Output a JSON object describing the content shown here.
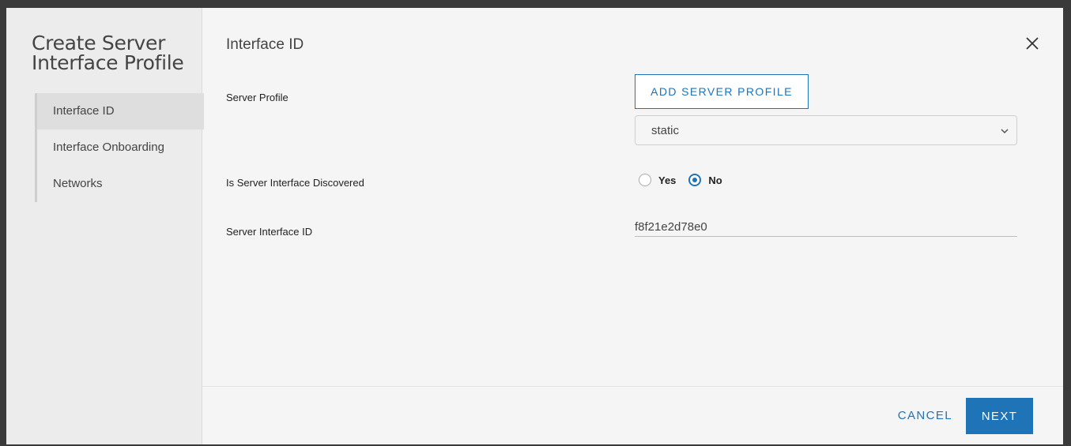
{
  "sidebar": {
    "title_line1": "Create Server",
    "title_line2": "Interface Profile",
    "steps": [
      {
        "label": "Interface ID",
        "active": true
      },
      {
        "label": "Interface Onboarding",
        "active": false
      },
      {
        "label": "Networks",
        "active": false
      }
    ]
  },
  "main": {
    "title": "Interface ID",
    "server_profile": {
      "label": "Server Profile",
      "add_button": "ADD SERVER PROFILE",
      "selected": "static"
    },
    "discovered": {
      "label": "Is Server Interface Discovered",
      "options": [
        "Yes",
        "No"
      ],
      "selected": "No"
    },
    "interface_id": {
      "label": "Server Interface ID",
      "value": "f8f21e2d78e0"
    }
  },
  "footer": {
    "cancel": "CANCEL",
    "next": "NEXT"
  },
  "colors": {
    "accent": "#1f73b7"
  },
  "icons": {
    "close": "close-icon",
    "select": "chevron-down-icon"
  }
}
